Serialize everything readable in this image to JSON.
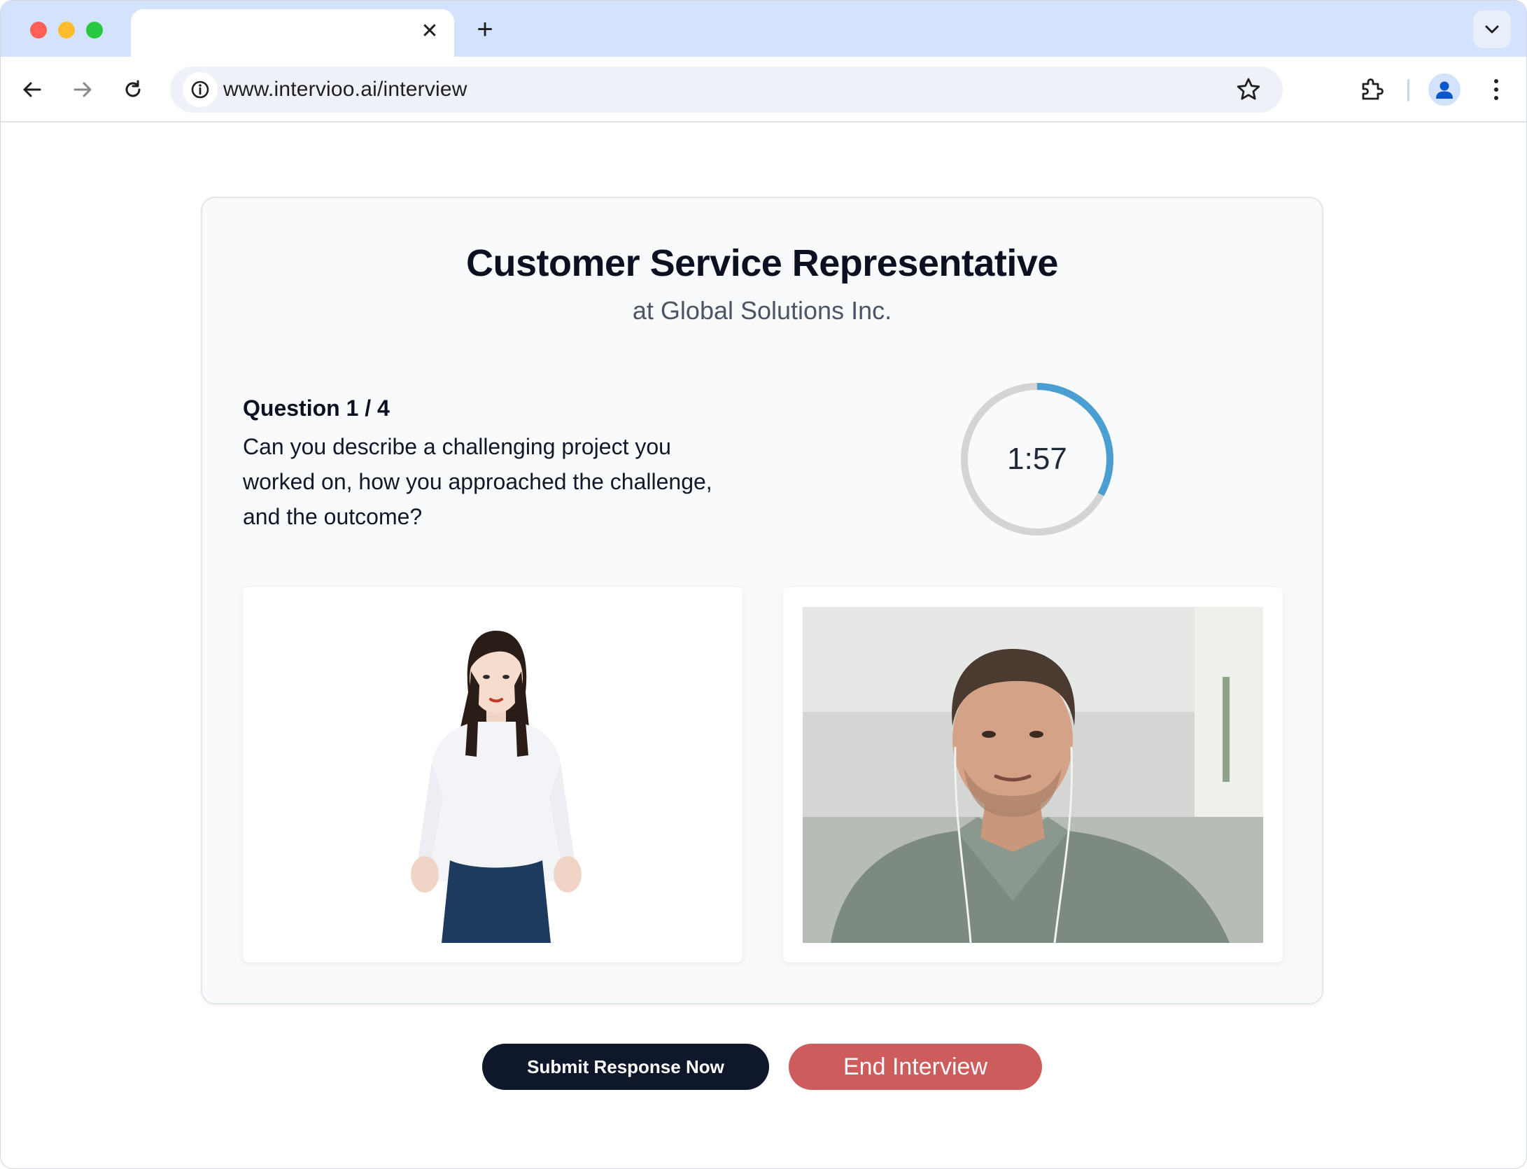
{
  "browser": {
    "tab_title": "",
    "tab_close_glyph": "✕",
    "new_tab_glyph": "+",
    "url": "www.intervioo.ai/interview",
    "icons": {
      "back": "back-arrow-icon",
      "forward": "forward-arrow-icon",
      "reload": "reload-icon",
      "site_info": "info-icon",
      "bookmark": "star-icon",
      "extensions": "puzzle-piece-icon",
      "profile": "profile-icon",
      "menu": "kebab-menu-icon",
      "tab_search": "chevron-down-icon"
    }
  },
  "interview": {
    "job_title": "Customer Service Representative",
    "company": "at Global Solutions Inc.",
    "question_header": "Question 1 / 4",
    "question_number": 1,
    "question_total": 4,
    "question_text": "Can you describe a challenging project you worked on, how you approached the challenge, and the outcome?",
    "timer": {
      "display": "1:57",
      "progress_fraction": 0.33,
      "track_color": "#d4d4d4",
      "progress_color": "#4a9ed2"
    }
  },
  "media": {
    "interviewer_avatar": "ai-interviewer-avatar",
    "candidate_camera": "candidate-webcam-feed"
  },
  "actions": {
    "submit_label": "Submit Response Now",
    "end_label": "End Interview",
    "submit_color": "#0f172a",
    "end_color": "#cd5c5c"
  }
}
